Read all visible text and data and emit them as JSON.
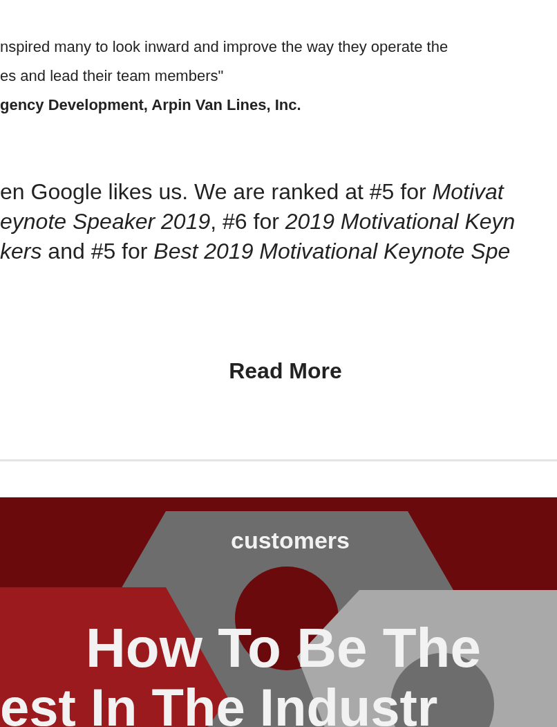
{
  "quote": {
    "lines": [
      "nspired many to look inward and improve the way they operate the",
      "es and lead their team members\""
    ],
    "attribution": "gency Development,  Arpin Van Lines, Inc."
  },
  "ranking": {
    "lines": [
      "en Google likes us. We are ranked at #5 for *Motivat*",
      "*eynote Speaker 2019*, #6 for *2019 Motivational Keyn*",
      "*kers* and #5 for *Best 2019 Motivational Keynote Spe*"
    ]
  },
  "read_more": "Read More",
  "banner": {
    "tag": "customers",
    "headline": [
      "How To Be The",
      "est In The Industr"
    ]
  }
}
